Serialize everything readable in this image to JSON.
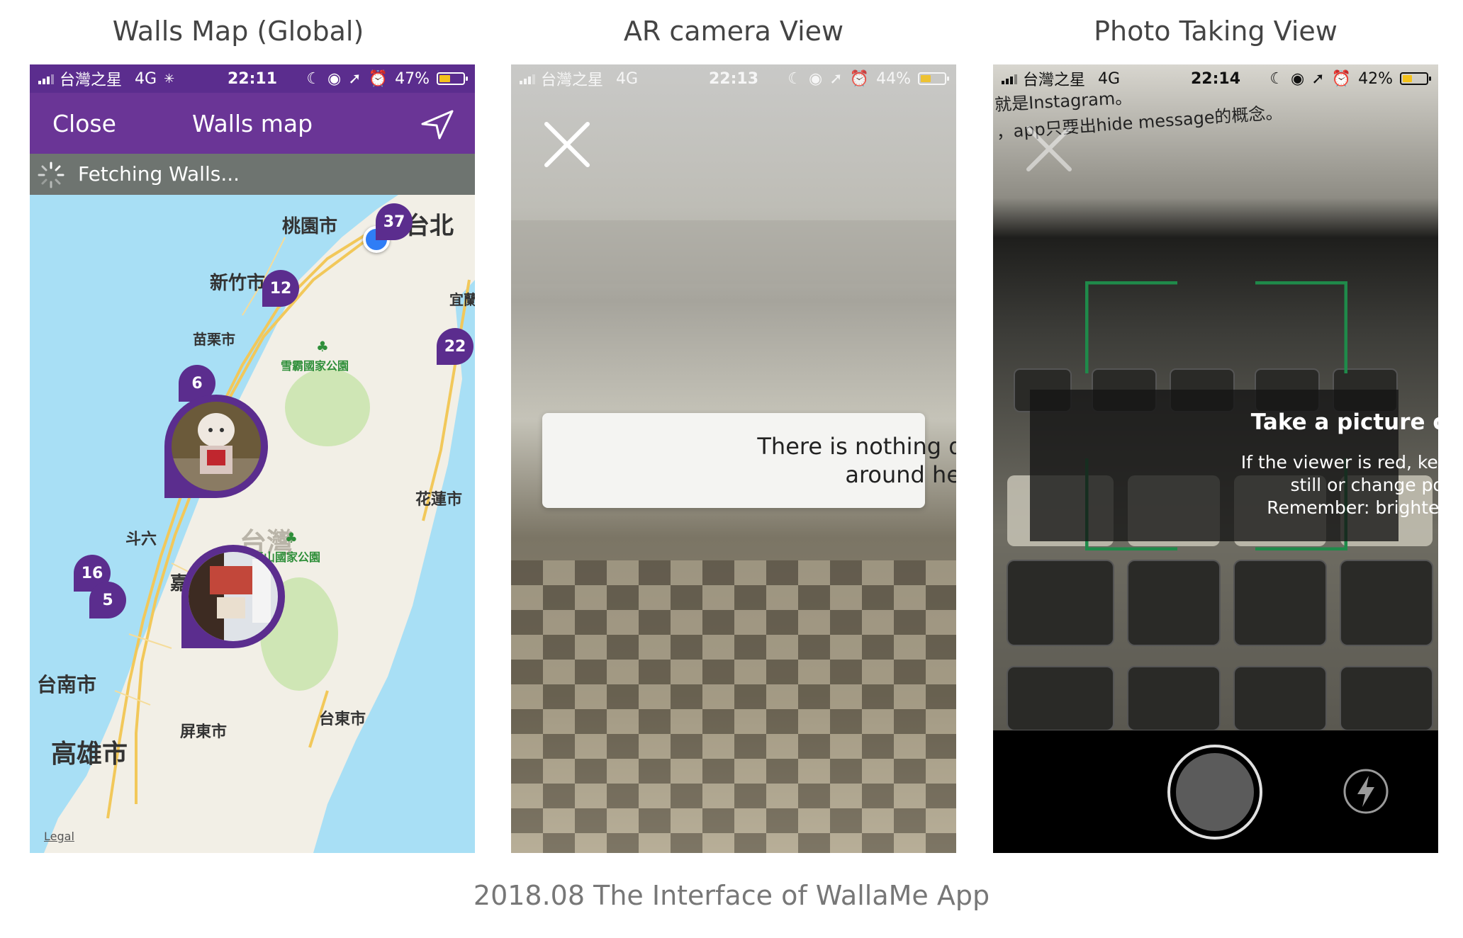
{
  "captions": {
    "map": "Walls Map (Global)",
    "ar": "AR camera View",
    "photo": "Photo Taking View"
  },
  "footer": "2018.08 The Interface of WallaMe App",
  "phone_map": {
    "status": {
      "carrier": "台灣之星",
      "network": "4G",
      "time": "22:11",
      "battery": "47%",
      "battery_level": 0.47
    },
    "nav": {
      "close": "Close",
      "title": "Walls map",
      "location_icon": "location-arrow-icon"
    },
    "fetching": "Fetching Walls...",
    "clusters": [
      "37",
      "12",
      "22",
      "6",
      "16",
      "5"
    ],
    "cities": {
      "taoyuan": "桃園市",
      "taipei": "台北",
      "hsinchu": "新竹市",
      "yilan": "宜蘭",
      "miaoli": "苗栗市",
      "hualien": "花蓮市",
      "douliu": "斗六",
      "chiayi": "嘉義市",
      "taiwan": "台灣",
      "tainan": "台南市",
      "kaohsiung": "高雄市",
      "pingtung": "屏東市",
      "taitung": "台東市"
    },
    "parks": {
      "shei_pa": "雪霸國家公園",
      "yushan": "玉山國家公園"
    },
    "legal": "Legal"
  },
  "phone_ar": {
    "status": {
      "carrier": "台灣之星",
      "network": "4G",
      "time": "22:13",
      "battery": "44%",
      "battery_level": 0.44
    },
    "message_line1": "There is nothing discoverable",
    "message_line2": "around here..."
  },
  "phone_photo": {
    "status": {
      "carrier": "台灣之星",
      "network": "4G",
      "time": "22:14",
      "battery": "42%",
      "battery_level": 0.42
    },
    "background_text_1": "就是Instagram。",
    "background_text_2": "，app只要出hide message的概念。",
    "instruction_title": "Take a picture of a wall.",
    "instruction_line1": "If the viewer is red, keep the phone",
    "instruction_line2": "still or change positions.",
    "instruction_line3": "Remember: brighter is better.",
    "viewfinder_color": "#1f8a4a"
  }
}
